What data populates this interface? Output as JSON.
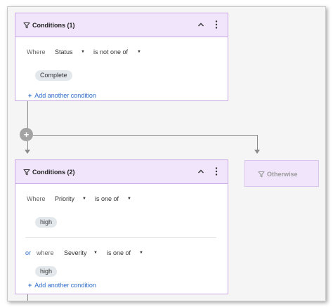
{
  "condition_block_1": {
    "title": "Conditions (1)",
    "rows": [
      {
        "prefix": "Where",
        "field": "Status",
        "operator": "is not one of",
        "values": [
          "Complete"
        ]
      }
    ],
    "add_label": "Add another condition"
  },
  "condition_block_2": {
    "title": "Conditions (2)",
    "rows": [
      {
        "prefix": "Where",
        "field": "Priority",
        "operator": "is one of",
        "values": [
          "high"
        ]
      },
      {
        "conjunction": "or",
        "prefix": "where",
        "field": "Severity",
        "operator": "is one of",
        "values": [
          "high"
        ]
      }
    ],
    "add_label": "Add another condition"
  },
  "add_branch": {
    "symbol": "+"
  },
  "otherwise": {
    "title": "Otherwise"
  },
  "icons": {
    "filter": "filter-funnel-icon",
    "collapse": "chevron-up-icon",
    "menu": "more-vertical-icon",
    "dropdown": "caret-down-icon",
    "add": "plus-icon"
  },
  "colors": {
    "card_header": "#f1e5fb",
    "card_border": "#c9a8e6",
    "link": "#2a6ac8",
    "chip": "#e2e8ec",
    "connector": "#8c8c8c"
  }
}
